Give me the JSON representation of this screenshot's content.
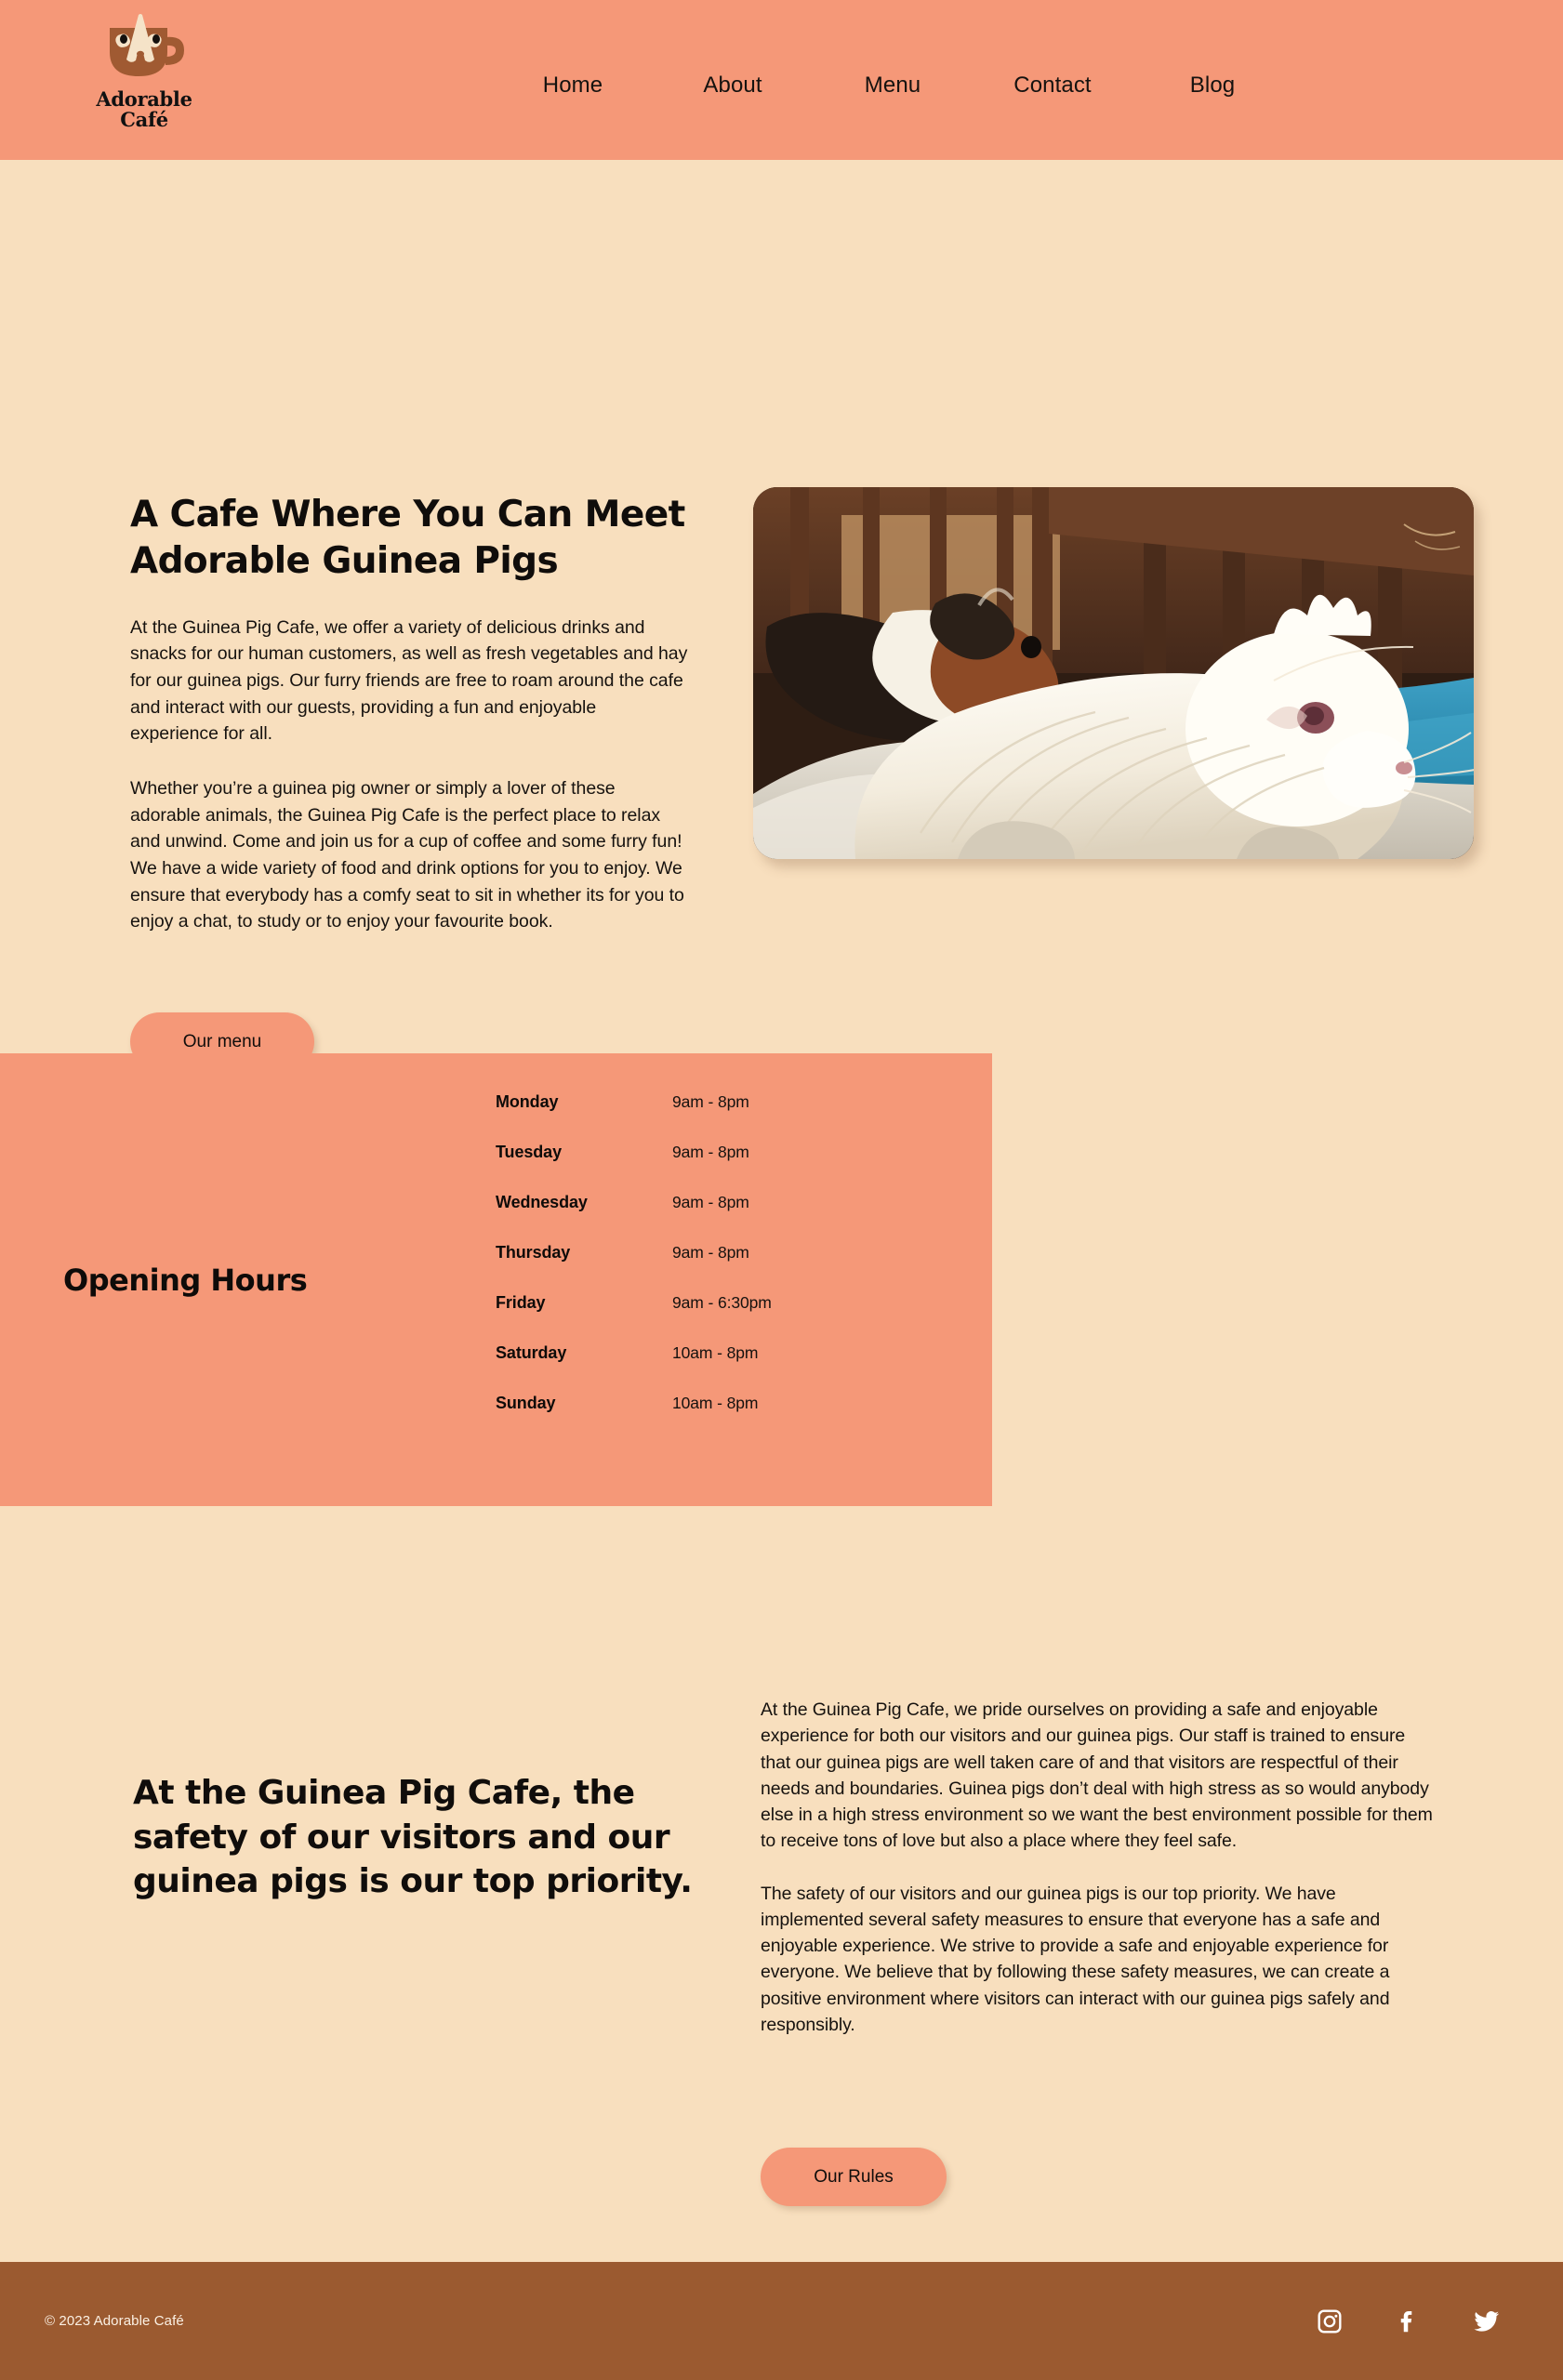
{
  "header": {
    "brand": {
      "logo_icon": "coffee-cup-dog-logo",
      "line1": "Adorable",
      "line2": "Café"
    },
    "nav": [
      {
        "label": "Home"
      },
      {
        "label": "About"
      },
      {
        "label": "Menu"
      },
      {
        "label": "Contact"
      },
      {
        "label": "Blog"
      }
    ]
  },
  "hero": {
    "title": "A Cafe Where You Can Meet Adorable Guinea Pigs",
    "paragraph1": "At the Guinea Pig Cafe, we offer a variety of delicious drinks and snacks for our human customers, as well as fresh vegetables and hay for our guinea pigs. Our furry friends are free to roam around the cafe and interact with our guests, providing a fun and enjoyable experience for all.",
    "paragraph2": "Whether you’re a guinea pig owner or simply a lover of these adorable animals, the Guinea Pig Cafe is the perfect place to relax and unwind. Come and join us for a cup of coffee and some furry fun! We have a wide variety of food and drink options for you to enjoy. We ensure that everybody has a comfy seat to sit in whether its for you to enjoy a chat, to study or to enjoy your favourite book.",
    "button_label": "Our menu",
    "photo_alt": "two long-haired guinea pigs resting on a fleece blanket inside a wooden hutch"
  },
  "hours": {
    "title": "Opening Hours",
    "rows": [
      {
        "day": "Monday",
        "time": "9am - 8pm"
      },
      {
        "day": "Tuesday",
        "time": "9am - 8pm"
      },
      {
        "day": "Wednesday",
        "time": "9am - 8pm"
      },
      {
        "day": "Thursday",
        "time": "9am - 8pm"
      },
      {
        "day": "Friday",
        "time": "9am - 6:30pm"
      },
      {
        "day": "Saturday",
        "time": "10am - 8pm"
      },
      {
        "day": "Sunday",
        "time": "10am - 8pm"
      }
    ]
  },
  "safety": {
    "heading": "At the Guinea Pig Cafe, the safety of our visitors and our guinea pigs is our top priority.",
    "paragraph1": "At the Guinea Pig Cafe, we pride ourselves on providing a safe and enjoyable experience for both our visitors and our guinea pigs. Our staff is trained to ensure that our guinea pigs are well taken care of and that visitors are respectful of their needs and boundaries. Guinea pigs don’t deal with high stress as so would anybody else in a high stress environment so we want the best environment possible for them to receive tons of love but also a place where they feel safe.",
    "paragraph2": "The safety of our visitors and our guinea pigs is our top priority. We have implemented several safety measures to ensure that everyone has a safe and enjoyable experience. We strive to provide a safe and enjoyable experience for everyone. We believe that by following these safety measures, we can create a positive environment where visitors can interact with our guinea pigs safely and responsibly.",
    "button_label": "Our Rules"
  },
  "footer": {
    "copyright": "© 2023 Adorable Café",
    "social": [
      {
        "name": "instagram",
        "label": "Instagram"
      },
      {
        "name": "facebook",
        "label": "Facebook"
      },
      {
        "name": "twitter",
        "label": "Twitter"
      }
    ]
  },
  "colors": {
    "salmon": "#f59878",
    "cream": "#f8dfbe",
    "brown": "#9b5a30",
    "logo_brown": "#a05a32",
    "logo_cream": "#f5e3c8",
    "ink": "#100d0b"
  }
}
